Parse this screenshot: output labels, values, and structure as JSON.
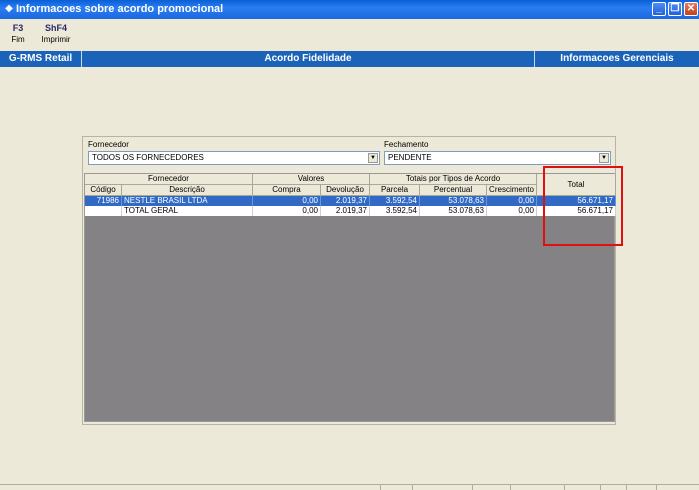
{
  "window": {
    "title": "Informacoes sobre acordo promocional",
    "min_label": "_",
    "max_label": "❐",
    "close_label": "✕"
  },
  "toolbar": {
    "fim_key": "F3",
    "fim_label": "Fim",
    "imprimir_key": "ShF4",
    "imprimir_label": "Imprimir"
  },
  "band": {
    "left": "G-RMS Retail",
    "center": "Acordo Fidelidade",
    "right": "Informacoes Gerenciais"
  },
  "filters": {
    "fornecedor_label": "Fornecedor",
    "fornecedor_value": "TODOS OS FORNECEDORES",
    "fechamento_label": "Fechamento",
    "fechamento_value": "PENDENTE"
  },
  "grid": {
    "group_fornecedor": "Fornecedor",
    "group_valores": "Valores",
    "group_totais": "Totais por Tipos de Acordo",
    "col_total": "Total",
    "col_codigo": "Código",
    "col_descricao": "Descrição",
    "col_compra": "Compra",
    "col_devolucao": "Devolução",
    "col_parcela": "Parcela",
    "col_percentual": "Percentual",
    "col_crescimento": "Crescimento",
    "rows": [
      {
        "codigo": "71986",
        "descricao": "NESTLE BRASIL LTDA",
        "compra": "0,00",
        "devolucao": "2.019,37",
        "parcela": "3.592,54",
        "percentual": "53.078,63",
        "crescimento": "0,00",
        "total": "56.671,17"
      },
      {
        "codigo": "",
        "descricao": "TOTAL GERAL",
        "compra": "0,00",
        "devolucao": "2.019,37",
        "parcela": "3.592,54",
        "percentual": "53.078,63",
        "crescimento": "0,00",
        "total": "56.671,17"
      }
    ]
  },
  "colors": {
    "band": "#1b63b8",
    "selection": "#316ac5",
    "highlight": "#e01010",
    "grid_empty": "#858285"
  }
}
